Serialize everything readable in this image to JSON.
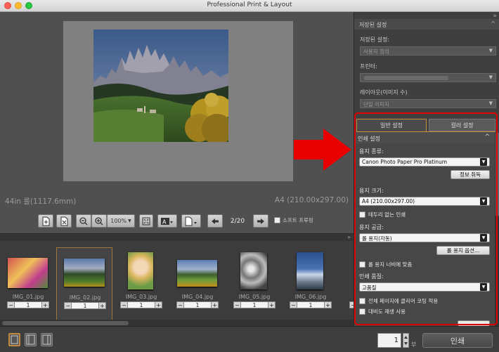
{
  "window": {
    "title": "Professional Print & Layout"
  },
  "preview": {
    "roll_size": "44in 롤(1117.6mm)",
    "paper_size": "A4 (210.00x297.00)"
  },
  "toolbar": {
    "zoom_value": "100%",
    "page_indicator": "2/20",
    "soft_proof_label": "소프트 프루핑"
  },
  "filmstrip": {
    "thumbnails": [
      {
        "name": "IMG_01.jpg",
        "copies": "1",
        "selected": false
      },
      {
        "name": "IMG_02.jpg",
        "copies": "1",
        "selected": true
      },
      {
        "name": "IMG_03.jpg",
        "copies": "1",
        "selected": false
      },
      {
        "name": "IMG_04.jpg",
        "copies": "1",
        "selected": false
      },
      {
        "name": "IMG_05.jpg",
        "copies": "1",
        "selected": false
      },
      {
        "name": "IMG_06.jpg",
        "copies": "1",
        "selected": false
      }
    ],
    "stepper_minus": "−",
    "stepper_plus": "+"
  },
  "bottom": {
    "copies": "1",
    "copies_unit": "부",
    "print_label": "인쇄"
  },
  "panel": {
    "saved_settings_header": "저장된 설정",
    "saved_settings_label": "저장된 설정:",
    "saved_settings_value": "사용자 정의",
    "printer_label": "프린터:",
    "layout_label": "레이아웃(이미지 수)",
    "layout_value": "단일 이미지",
    "tabs": {
      "general": "일반 설정",
      "color": "컬러 설정"
    },
    "print_settings_header": "인쇄 설정",
    "media_type_label": "용지 종류:",
    "media_type_value": "Canon Photo Paper Pro Platinum",
    "get_info_button": "정보 취득",
    "paper_size_label": "용지 크기:",
    "paper_size_value": "A4 (210.00x297.00)",
    "borderless_label": "테두리 없는 인쇄",
    "paper_source_label": "용지 공급:",
    "paper_source_value": "롤 용지(자동)",
    "roll_options_button": "롤 용지 옵션...",
    "fit_roll_label": "롤 용지 너비에 맞춤",
    "print_quality_label": "인쇄 품질:",
    "print_quality_value": "고품질",
    "clear_coating_label": "전체 페이지에 클리어 코팅 적용",
    "contrast_label": "대비도 재생 사용"
  }
}
